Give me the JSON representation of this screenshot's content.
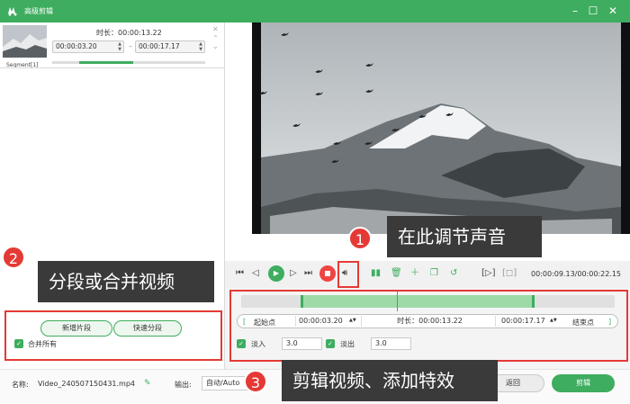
{
  "window": {
    "title": "高级剪辑"
  },
  "segment": {
    "label": "Segment[1]",
    "duration_label": "时长：",
    "duration_value": "00:00:13.22",
    "start": "00:00:03.20",
    "end": "00:00:17.17"
  },
  "player": {
    "timecode": "00:00:09.13/00:00:22.15"
  },
  "editor": {
    "start_label": "起始点",
    "start_value": "00:00:03.20",
    "duration_label": "时长：",
    "duration_value": "00:00:13.22",
    "end_value": "00:00:17.17",
    "end_label": "结束点",
    "fade_in_label": "淡入",
    "fade_in_value": "3.0",
    "fade_out_label": "淡出",
    "fade_out_value": "3.0"
  },
  "segments_panel": {
    "new_segment": "新增片段",
    "quick_split": "快速分段",
    "merge_all": "合并所有"
  },
  "footer": {
    "name_label": "名称:",
    "name_value": "Video_240507150431.mp4",
    "output_label": "输出:",
    "output_value": "自动/Auto",
    "back": "返回",
    "edit": "剪辑"
  },
  "callouts": [
    {
      "number": "1",
      "text": "在此调节声音"
    },
    {
      "number": "2",
      "text": "分段或合并视频"
    },
    {
      "number": "3",
      "text": "剪辑视频、添加特效"
    }
  ],
  "colors": {
    "accent": "#3ead5f",
    "highlight": "#e53935",
    "callout_bg": "#3a3a3a"
  }
}
